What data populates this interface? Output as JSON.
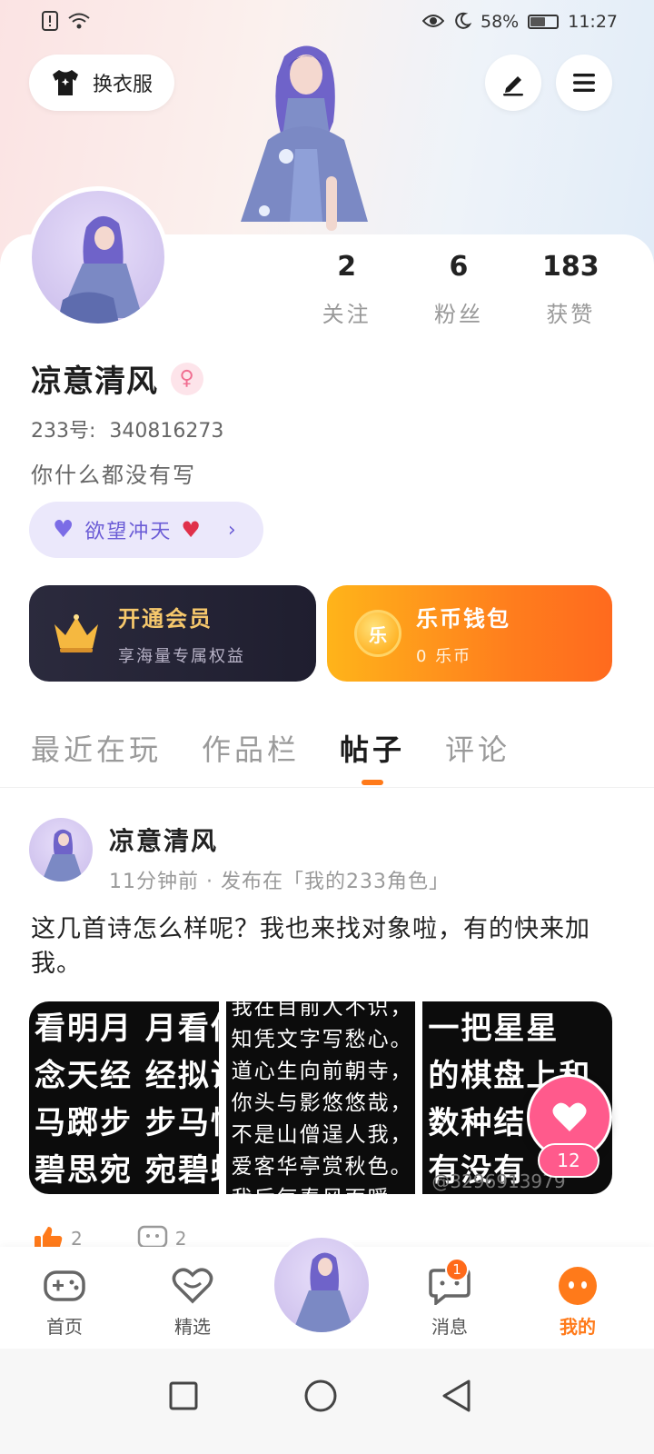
{
  "status_bar": {
    "battery": "58%",
    "time": "11:27",
    "battery_level": 0.58
  },
  "header": {
    "outfit_label": "换衣服"
  },
  "profile": {
    "nickname": "凉意清风",
    "uid_label": "233号:",
    "uid": "340816273",
    "bio": "你什么都没有写",
    "tag": "欲望冲天",
    "stats": [
      {
        "value": "2",
        "label": "关注"
      },
      {
        "value": "6",
        "label": "粉丝"
      },
      {
        "value": "183",
        "label": "获赞"
      }
    ]
  },
  "vip": {
    "title": "开通会员",
    "subtitle": "享海量专属权益"
  },
  "wallet": {
    "coin_glyph": "乐",
    "title": "乐币钱包",
    "subtitle": "0 乐币"
  },
  "tabs": [
    "最近在玩",
    "作品栏",
    "帖子",
    "评论"
  ],
  "post": {
    "author": "凉意清风",
    "meta": "11分钟前 · 发布在「我的233角色」",
    "text": "这几首诗怎么样呢？我也来找对象啦，有的快来加我。",
    "images": [
      {
        "lines": [
          "看明月 月看仙",
          "念天经 经拟诵",
          "马踯步 步马慢",
          "碧思宛 宛碧蛛"
        ]
      },
      {
        "lines": [
          "我在目前人不识，",
          "知凭文字写愁心。",
          "道心生向前朝寺，",
          "你头与影悠悠哉，",
          "不是山僧逞人我，",
          "爱客华亭赏秋色。",
          "我后每春风面暖"
        ]
      },
      {
        "lines": [
          "一把星星",
          "的棋盘上和",
          "数种结",
          "有没有"
        ]
      }
    ],
    "image_watermark": "@3296913979",
    "like_count": "12",
    "thumbs_count": "2",
    "comment_count": "2"
  },
  "bottom_nav": {
    "items": [
      {
        "label": "首页",
        "icon": "gamepad-icon"
      },
      {
        "label": "精选",
        "icon": "heart-outline-icon"
      },
      {
        "label": "消息",
        "icon": "chat-bubble-icon",
        "badge": "1"
      },
      {
        "label": "我的",
        "icon": "face-icon"
      }
    ]
  },
  "colors": {
    "accent": "#ff7a1a",
    "like_pink": "#ff5a8c",
    "tag_purple": "#6b5cd6",
    "vip_gold": "#f6c86c"
  }
}
